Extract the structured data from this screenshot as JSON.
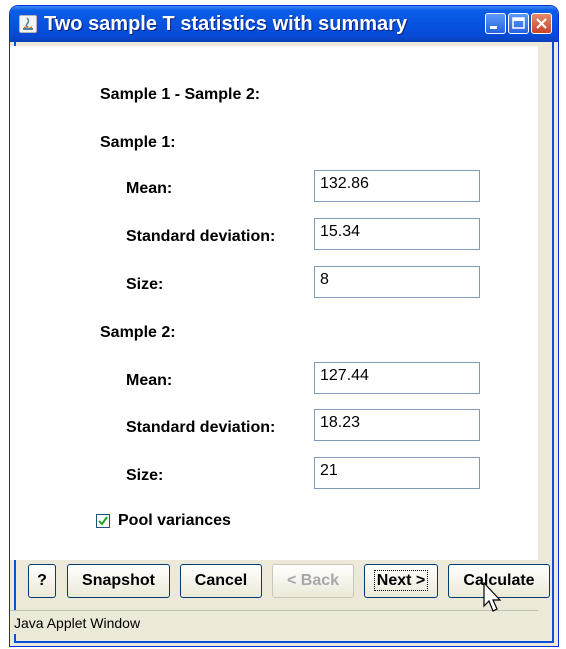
{
  "window": {
    "title": "Two sample T statistics with summary"
  },
  "form": {
    "difference_label": "Sample 1 - Sample 2:",
    "sample1": {
      "heading": "Sample 1:",
      "mean_label": "Mean:",
      "mean_value": "132.86",
      "sd_label": "Standard deviation:",
      "sd_value": "15.34",
      "size_label": "Size:",
      "size_value": "8"
    },
    "sample2": {
      "heading": "Sample 2:",
      "mean_label": "Mean:",
      "mean_value": "127.44",
      "sd_label": "Standard deviation:",
      "sd_value": "18.23",
      "size_label": "Size:",
      "size_value": "21"
    },
    "pool_label": "Pool variances",
    "pool_checked": true
  },
  "buttons": {
    "help": "?",
    "snapshot": "Snapshot",
    "cancel": "Cancel",
    "back": "< Back",
    "next": "Next >",
    "calculate": "Calculate"
  },
  "status": {
    "text": "Java Applet Window"
  },
  "colors": {
    "titlebar": "#0753e0",
    "window_bg": "#ece9d8",
    "field_border": "#7f9db9"
  }
}
